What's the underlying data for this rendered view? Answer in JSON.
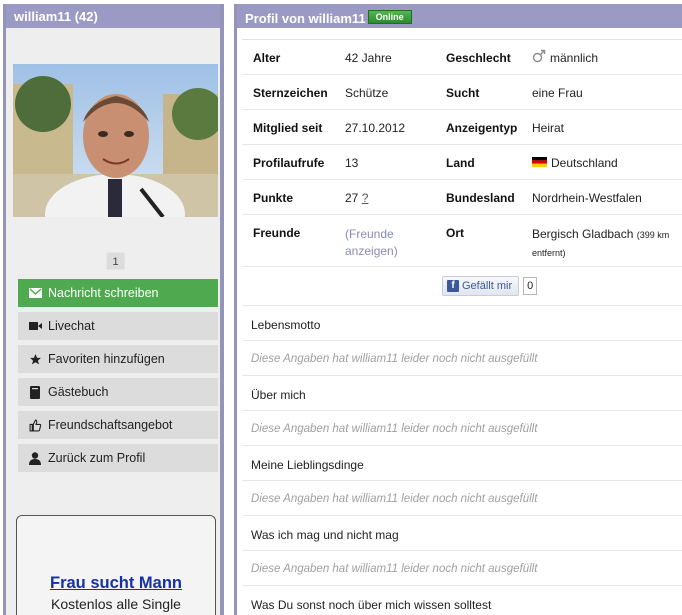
{
  "left": {
    "title": "william11 (42)",
    "pager": "1",
    "buttons": [
      {
        "label": "Nachricht schreiben",
        "icon": "envelope-icon"
      },
      {
        "label": "Livechat",
        "icon": "video-camera-icon"
      },
      {
        "label": "Favoriten hinzufügen",
        "icon": "star-icon"
      },
      {
        "label": "Gästebuch",
        "icon": "book-icon"
      },
      {
        "label": "Freundschaftsangebot",
        "icon": "thumbs-up-icon"
      },
      {
        "label": "Zurück zum Profil",
        "icon": "user-icon"
      }
    ],
    "ad": {
      "title": "Frau sucht Mann",
      "subtitle": "Kostenlos alle Single"
    }
  },
  "right": {
    "title": "Profil von william11",
    "online_badge": "Online",
    "rows": [
      {
        "l1": "Alter",
        "v1": "42 Jahre",
        "l2": "Geschlecht",
        "v2": "männlich"
      },
      {
        "l1": "Sternzeichen",
        "v1": "Schütze",
        "l2": "Sucht",
        "v2": "eine Frau"
      },
      {
        "l1": "Mitglied seit",
        "v1": "27.10.2012",
        "l2": "Anzeigentyp",
        "v2": "Heirat"
      },
      {
        "l1": "Profilaufrufe",
        "v1": "13",
        "l2": "Land",
        "v2": "Deutschland"
      },
      {
        "l1": "Punkte",
        "v1": "27",
        "v1b": "?",
        "l2": "Bundesland",
        "v2": "Nordrhein-Westfalen"
      },
      {
        "l1": "Freunde",
        "v1a": "(Freunde",
        "v1c": "anzeigen)",
        "l2": "Ort",
        "v2": "Bergisch Gladbach",
        "v2small": "(399 km",
        "v2small2": "entfernt)"
      }
    ],
    "like": {
      "label": "Gefällt mir",
      "count": "0"
    },
    "sections": [
      {
        "title": "Lebensmotto",
        "empty": "Diese Angaben hat william11 leider noch nicht ausgefüllt"
      },
      {
        "title": "Über mich",
        "empty": "Diese Angaben hat william11 leider noch nicht ausgefüllt"
      },
      {
        "title": "Meine Lieblingsdinge",
        "empty": "Diese Angaben hat william11 leider noch nicht ausgefüllt"
      },
      {
        "title": "Was ich mag und nicht mag",
        "empty": "Diese Angaben hat william11 leider noch nicht ausgefüllt"
      },
      {
        "title": "Was Du sonst noch über mich wissen solltest"
      }
    ]
  },
  "colors": {
    "header": "#9a9ac4",
    "accent_green": "#4faa4f",
    "link": "#1530a8"
  }
}
